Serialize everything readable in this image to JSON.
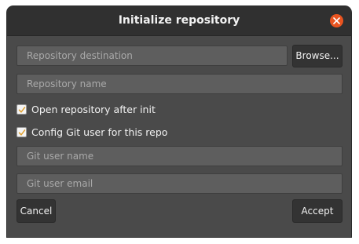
{
  "dialog": {
    "title": "Initialize repository"
  },
  "destination": {
    "placeholder": "Repository destination",
    "value": "",
    "browse_label": "Browse..."
  },
  "repo_name": {
    "placeholder": "Repository name",
    "value": ""
  },
  "options": {
    "open_after_init": {
      "label": "Open repository after init",
      "checked": true
    },
    "config_git_user": {
      "label": "Config Git user for this repo",
      "checked": true
    }
  },
  "git_user_name": {
    "placeholder": "Git user name",
    "value": ""
  },
  "git_user_email": {
    "placeholder": "Git user email",
    "value": ""
  },
  "actions": {
    "cancel_label": "Cancel",
    "accept_label": "Accept"
  },
  "colors": {
    "accent_close": "#e95420",
    "window_bg": "#4a4a4a",
    "titlebar_bg": "#303030"
  }
}
